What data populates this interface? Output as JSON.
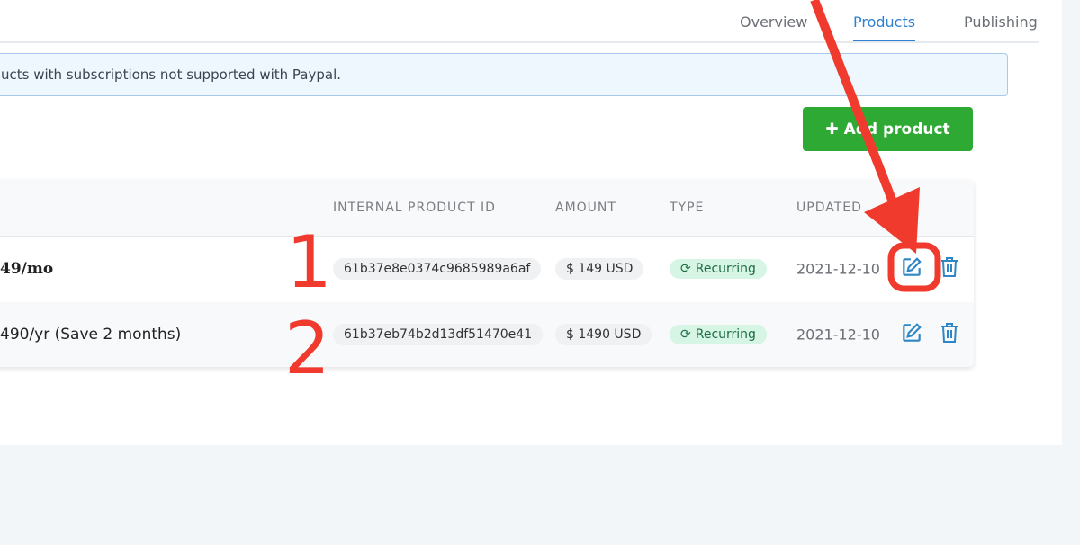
{
  "tabs": [
    {
      "label": "Overview",
      "active": false
    },
    {
      "label": "Products",
      "active": true
    },
    {
      "label": "Publishing",
      "active": false
    }
  ],
  "alert": {
    "text": "ucts with subscriptions not supported with Paypal."
  },
  "add_button": {
    "label": "Add product",
    "icon": "plus-icon",
    "color": "#2eaa34"
  },
  "table": {
    "headers": [
      "INTERNAL PRODUCT ID",
      "AMOUNT",
      "TYPE",
      "UPDATED"
    ],
    "rows": [
      {
        "name": "49/mo",
        "id": "61b37e8e0374c9685989a6af",
        "amount": "$ 149 USD",
        "type": "Recurring",
        "updated": "2021-12-10"
      },
      {
        "name": "490/yr (Save 2 months)",
        "id": "61b37eb74b2d13df51470e41",
        "amount": "$ 1490 USD",
        "type": "Recurring",
        "updated": "2021-12-10"
      }
    ]
  },
  "annotations": {
    "step1": "1",
    "step2": "2",
    "color": "#f03a2e"
  }
}
